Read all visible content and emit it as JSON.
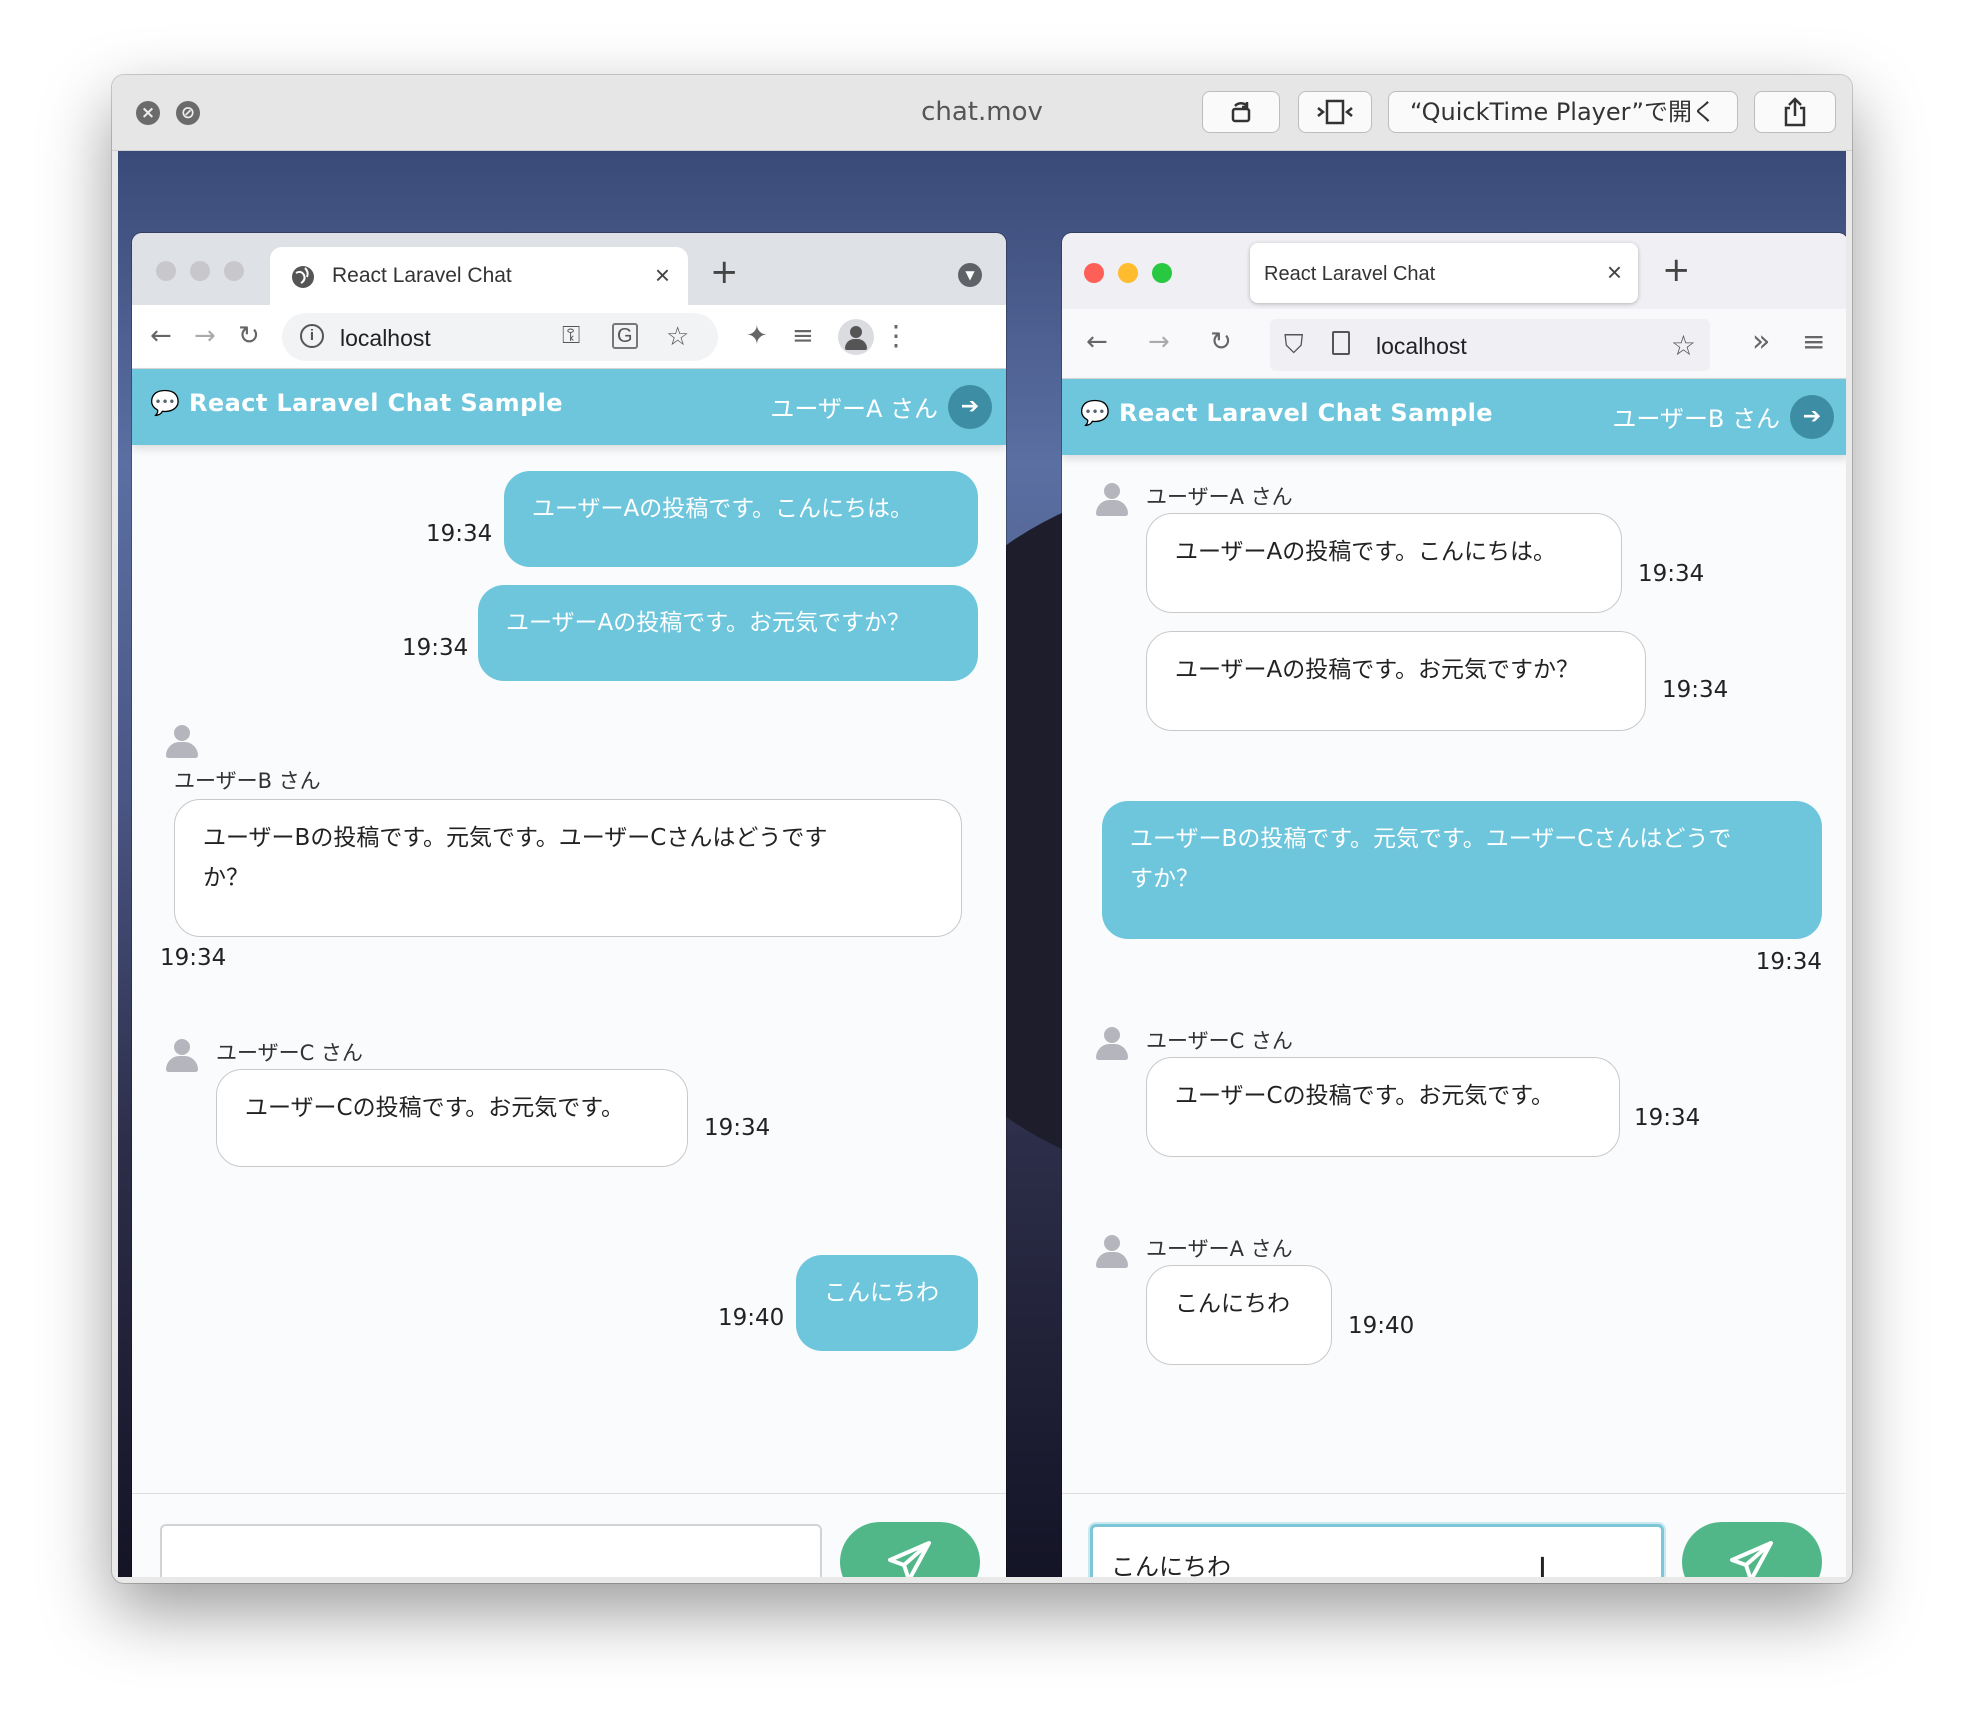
{
  "player": {
    "title": "chat.mov",
    "open_label": "“QuickTime Player”で開く"
  },
  "windows": [
    {
      "tab_title": "React Laravel Chat",
      "url": "localhost",
      "app_title": "React Laravel Chat Sample",
      "user_label": "ユーザーA さん",
      "messages": [
        {
          "text": "ユーザーAの投稿です。こんにちは。",
          "time": "19:34"
        },
        {
          "text": "ユーザーAの投稿です。お元気ですか？",
          "time": "19:34"
        },
        {
          "sender": "ユーザーB さん",
          "text_line1": "ユーザーBの投稿です。元気です。ユーザーCさんはどうです",
          "text_line2": "か？",
          "time": "19:34"
        },
        {
          "sender": "ユーザーC さん",
          "text": "ユーザーCの投稿です。お元気です。",
          "time": "19:34"
        },
        {
          "text": "こんにちわ",
          "time": "19:40"
        }
      ],
      "input_value": ""
    },
    {
      "tab_title": "React Laravel Chat",
      "url": "localhost",
      "app_title": "React Laravel Chat Sample",
      "user_label": "ユーザーB さん",
      "messages": [
        {
          "sender": "ユーザーA さん",
          "text": "ユーザーAの投稿です。こんにちは。",
          "time": "19:34"
        },
        {
          "text": "ユーザーAの投稿です。お元気ですか？",
          "time": "19:34"
        },
        {
          "text_line1": "ユーザーBの投稿です。元気です。ユーザーCさんはどうで",
          "text_line2": "すか？",
          "time": "19:34"
        },
        {
          "sender": "ユーザーC さん",
          "text": "ユーザーCの投稿です。お元気です。",
          "time": "19:34"
        },
        {
          "sender": "ユーザーA さん",
          "text": "こんにちわ",
          "time": "19:40"
        }
      ],
      "input_value": "こんにちわ"
    }
  ],
  "colors": {
    "accent": "#6ec6dc",
    "send": "#52b788",
    "logout": "#3d8ea5"
  }
}
